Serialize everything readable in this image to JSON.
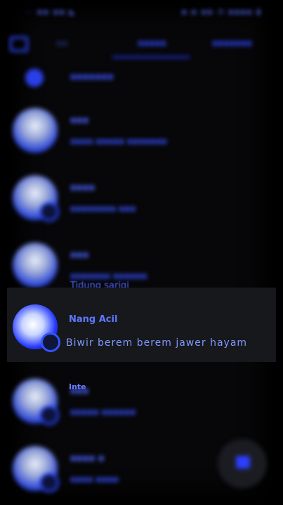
{
  "statusbar": {
    "left": "⋯ ▪▪ ▪▪ ◣",
    "right": "▪.▪ ▪▪ ◔ ▪▪▪▪ ▮"
  },
  "tabs": [
    {
      "label": "▪▪"
    },
    {
      "label": "▪▪▪▪▪"
    },
    {
      "label": "▪▪▪▪▪▪▪"
    }
  ],
  "header_row": {
    "label": "▪▪▪▪▪▪▪"
  },
  "chats": [
    {
      "name": "▪▪▪",
      "message": "▪▪▪▪ ▪▪▪▪▪ ▪▪▪▪▪▪▪"
    },
    {
      "name": "▪▪▪▪",
      "message": "▪▪▪▪▪▪▪▪ ▪▪▪"
    },
    {
      "name": "▪▪▪",
      "message": "▪▪▪▪▪▪▪ ▪▪▪▪▪▪"
    },
    {
      "name": "▪▪▪",
      "message": "▪▪▪▪▪ ▪▪▪▪▪▪"
    },
    {
      "name": "▪▪▪▪ ▪",
      "message": "▪▪▪▪ ▪▪▪▪"
    }
  ],
  "highlight": {
    "top_cut_text": "Tidung sarigi",
    "name": "Nang Acil",
    "message": "Biwir berem berem jawer hayam"
  },
  "typing_label": "Inte",
  "colors": {
    "accent": "#2f48ff",
    "background": "#070709",
    "highlight_bg": "#17181c"
  },
  "icons": {
    "camera": "camera-icon",
    "fab": "new-chat-icon"
  }
}
